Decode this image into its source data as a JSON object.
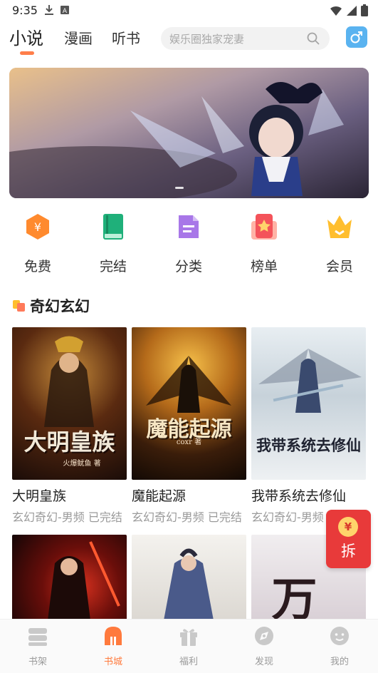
{
  "status_bar": {
    "time": "9:35"
  },
  "header": {
    "tabs": [
      {
        "label": "小说",
        "active": true
      },
      {
        "label": "漫画",
        "active": false
      },
      {
        "label": "听书",
        "active": false
      }
    ],
    "search": {
      "placeholder": "娱乐圈独家宠妻"
    },
    "accent_color": "#ff7e4a"
  },
  "categories": [
    {
      "label": "免费",
      "icon": "coin-hexagon-icon"
    },
    {
      "label": "完结",
      "icon": "book-icon"
    },
    {
      "label": "分类",
      "icon": "document-icon"
    },
    {
      "label": "榜单",
      "icon": "ranking-icon"
    },
    {
      "label": "会员",
      "icon": "crown-icon"
    }
  ],
  "section": {
    "title": "奇幻玄幻"
  },
  "books": [
    {
      "title": "大明皇族",
      "meta": "玄幻奇幻-男频 已完结",
      "cover_text": "大明皇族",
      "cover_author": "火爆鱿鱼 著"
    },
    {
      "title": "魔能起源",
      "meta": "玄幻奇幻-男频 已完结",
      "cover_text": "魔能起源",
      "cover_author": "coxr 著"
    },
    {
      "title": "我带系统去修仙",
      "meta": "玄幻奇幻-男频 已完结",
      "cover_text": "我带系统去修仙",
      "cover_author": ""
    },
    {
      "title": "",
      "meta": "",
      "cover_text": "",
      "cover_author": ""
    },
    {
      "title": "",
      "meta": "",
      "cover_text": "",
      "cover_author": ""
    },
    {
      "title": "",
      "meta": "",
      "cover_text": "万",
      "cover_author": ""
    }
  ],
  "red_packet": {
    "coin": "¥",
    "label": "拆"
  },
  "bottom_nav": [
    {
      "label": "书架",
      "icon": "bookshelf-icon",
      "active": false
    },
    {
      "label": "书城",
      "icon": "bookstore-icon",
      "active": true
    },
    {
      "label": "福利",
      "icon": "gift-icon",
      "active": false
    },
    {
      "label": "发现",
      "icon": "discover-icon",
      "active": false
    },
    {
      "label": "我的",
      "icon": "profile-icon",
      "active": false
    }
  ]
}
